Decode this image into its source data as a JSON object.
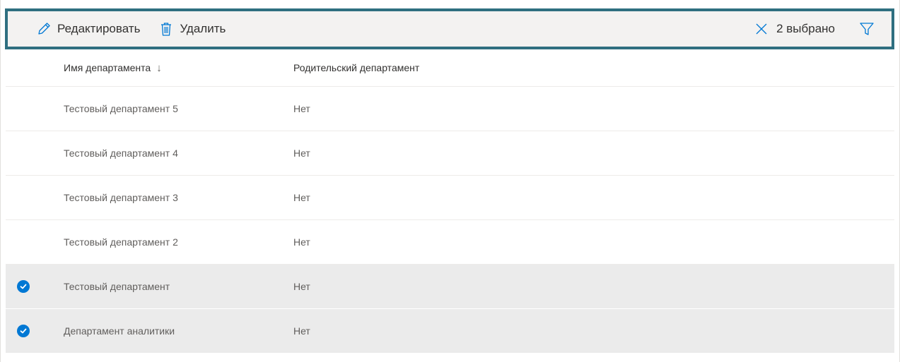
{
  "toolbar": {
    "edit_label": "Редактировать",
    "edit_icon": "pencil-icon",
    "delete_label": "Удалить",
    "delete_icon": "trash-icon",
    "clear_selection_icon": "close-icon",
    "selected_count_label": "2 выбрано",
    "filter_icon": "filter-icon"
  },
  "table": {
    "columns": [
      {
        "label": "Имя департамента",
        "sort": "descending",
        "sort_icon": "↓"
      },
      {
        "label": "Родительский департамент"
      }
    ],
    "rows": [
      {
        "name": "Тестовый департамент 5",
        "parent": "Нет",
        "selected": false
      },
      {
        "name": "Тестовый департамент 4",
        "parent": "Нет",
        "selected": false
      },
      {
        "name": "Тестовый департамент 3",
        "parent": "Нет",
        "selected": false
      },
      {
        "name": "Тестовый департамент 2",
        "parent": "Нет",
        "selected": false
      },
      {
        "name": "Тестовый департамент",
        "parent": "Нет",
        "selected": true
      },
      {
        "name": "Департамент аналитики",
        "parent": "Нет",
        "selected": true
      }
    ]
  },
  "colors": {
    "accent": "#0078d4",
    "toolbar_border": "#2f6f80",
    "toolbar_bg": "#f3f2f1",
    "selected_row_bg": "#ebebeb"
  }
}
